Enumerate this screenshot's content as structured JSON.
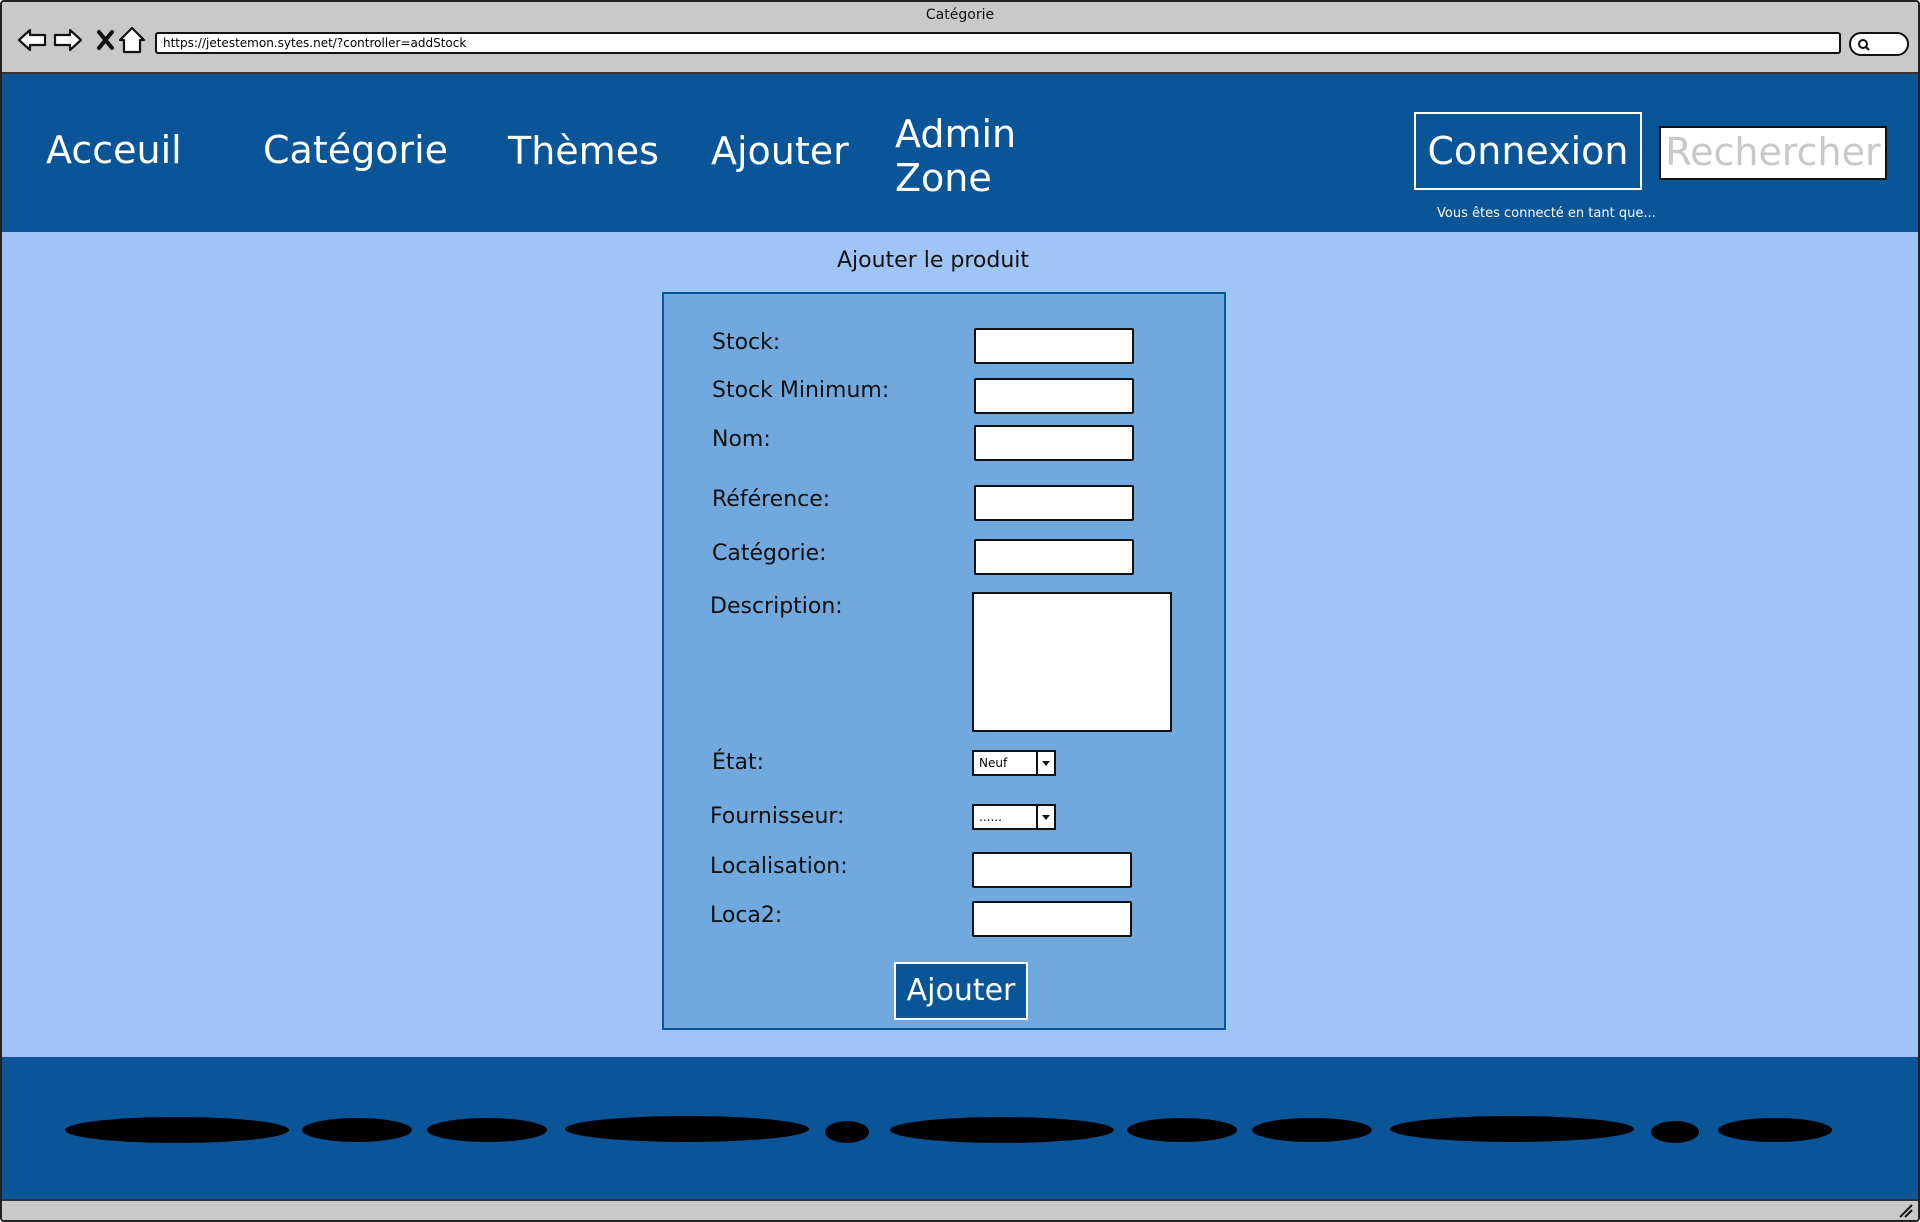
{
  "browser": {
    "window_title": "Catégorie",
    "url": "https://jetestemon.sytes.net/?controller=addStock"
  },
  "header": {
    "nav": [
      {
        "label": "Acceuil"
      },
      {
        "label": "Catégorie"
      },
      {
        "label": "Thèmes"
      },
      {
        "label": "Ajouter"
      },
      {
        "label_line1": "Admin",
        "label_line2": "Zone"
      }
    ],
    "connexion_label": "Connexion",
    "search_placeholder": "Rechercher",
    "connected_note": "Vous êtes connecté en tant que..."
  },
  "main": {
    "title": "Ajouter le produit",
    "form": {
      "stock_label": "Stock:",
      "stock_min_label": "Stock Minimum:",
      "nom_label": "Nom:",
      "reference_label": "Référence:",
      "categorie_label": "Catégorie:",
      "description_label": "Description:",
      "etat_label": "État:",
      "etat_value": "Neuf",
      "fournisseur_label": "Fournisseur:",
      "fournisseur_value": "......",
      "localisation_label": "Localisation:",
      "loca2_label": "Loca2:",
      "submit_label": "Ajouter"
    }
  },
  "colors": {
    "header_bg": "#0a5597",
    "main_bg": "#9fc4f5",
    "form_bg": "#71a8de"
  },
  "icons": [
    "back-arrow-icon",
    "forward-arrow-icon",
    "close-icon",
    "home-icon",
    "search-icon",
    "dropdown-arrow-icon",
    "resize-grip-icon"
  ]
}
